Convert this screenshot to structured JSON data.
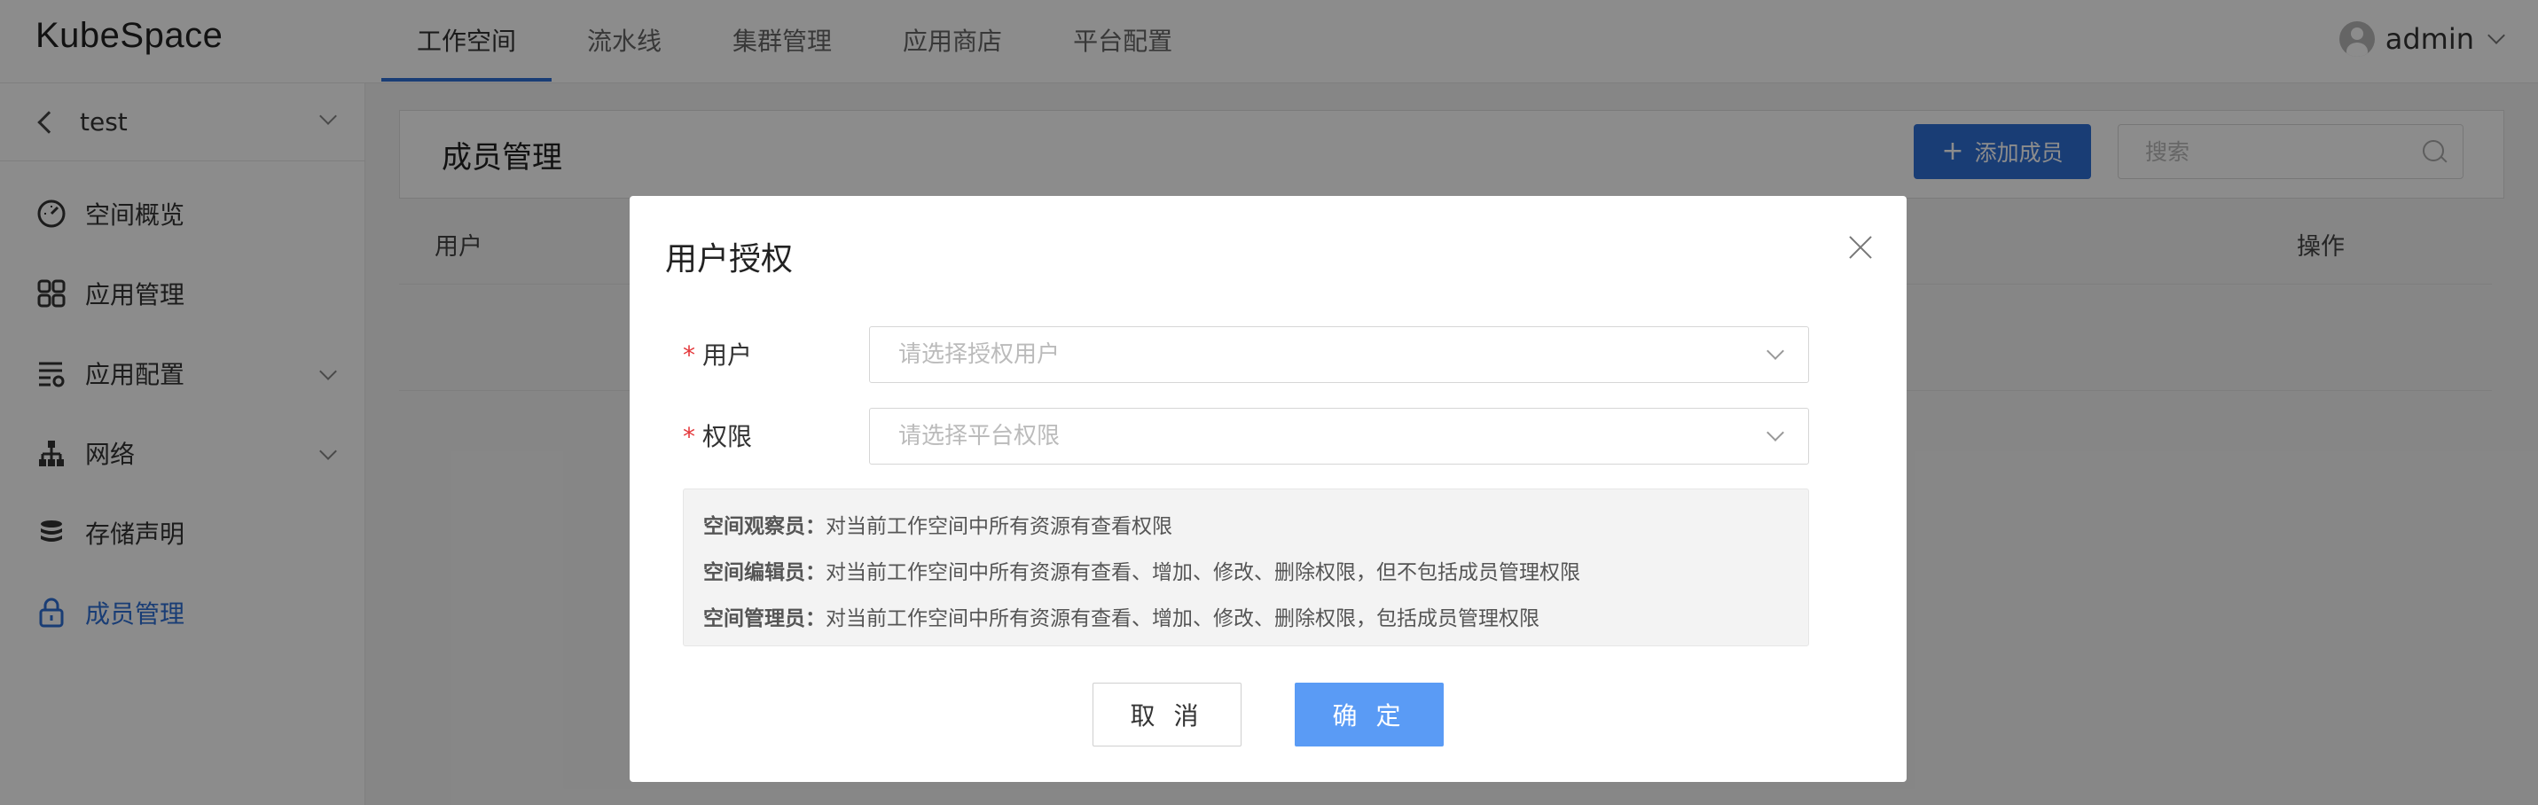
{
  "header": {
    "logo": "KubeSpace",
    "nav": [
      "工作空间",
      "流水线",
      "集群管理",
      "应用商店",
      "平台配置"
    ],
    "active_nav": "工作空间",
    "user": "admin"
  },
  "sidebar": {
    "space_name": "test",
    "items": [
      {
        "label": "空间概览",
        "icon": "dashboard-icon"
      },
      {
        "label": "应用管理",
        "icon": "apps-grid-icon"
      },
      {
        "label": "应用配置",
        "icon": "settings-list-icon"
      },
      {
        "label": "网络",
        "icon": "network-icon"
      },
      {
        "label": "存储声明",
        "icon": "database-icon"
      },
      {
        "label": "成员管理",
        "icon": "lock-icon"
      }
    ],
    "active": "成员管理"
  },
  "main": {
    "title": "成员管理",
    "add_button": "添加成员",
    "search_placeholder": "搜索",
    "columns": {
      "user": "用户",
      "ops": "操作"
    }
  },
  "modal": {
    "title": "用户授权",
    "user_label": "用户",
    "user_placeholder": "请选择授权用户",
    "perm_label": "权限",
    "perm_placeholder": "请选择平台权限",
    "roles": [
      {
        "name": "空间观察员：",
        "desc": "对当前工作空间中所有资源有查看权限"
      },
      {
        "name": "空间编辑员：",
        "desc": "对当前工作空间中所有资源有查看、增加、修改、删除权限，但不包括成员管理权限"
      },
      {
        "name": "空间管理员：",
        "desc": "对当前工作空间中所有资源有查看、增加、修改、删除权限，包括成员管理权限"
      }
    ],
    "cancel": "取 消",
    "ok": "确 定"
  },
  "colors": {
    "accent": "#2f6fd6",
    "ok_button": "#5a9bf5",
    "required": "#e4393c"
  }
}
